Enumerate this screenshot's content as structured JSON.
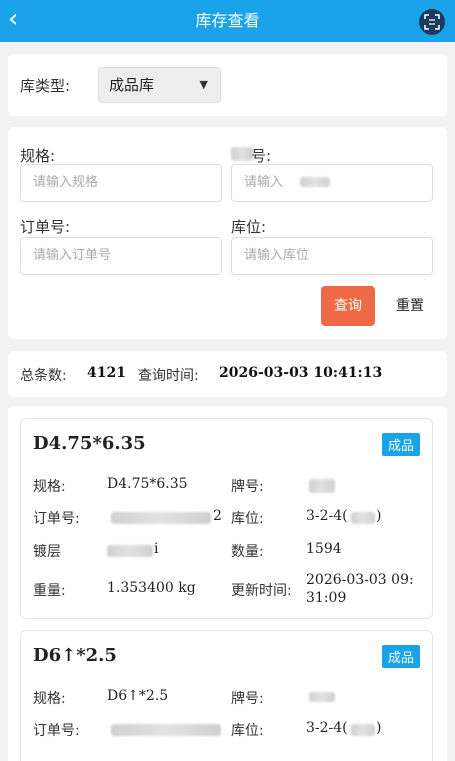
{
  "header": {
    "title": "库存查看",
    "back_icon": "chevron-left-icon",
    "scan_icon": "scan-icon"
  },
  "type_filter": {
    "label": "库类型:",
    "selected": "成品库"
  },
  "form": {
    "spec_label": "规格:",
    "spec_placeholder": "请输入规格",
    "brand_label": "号:",
    "brand_placeholder": "请输入",
    "order_label": "订单号:",
    "order_placeholder": "请输入订单号",
    "location_label": "库位:",
    "location_placeholder": "请输入库位",
    "query_button": "查询",
    "reset_button": "重置"
  },
  "summary": {
    "total_label": "总条数:",
    "total": "4121",
    "time_label": "查询时间:",
    "time": "2026-03-03 10:41:13"
  },
  "labels": {
    "spec": "规格:",
    "brand": "牌号:",
    "order": "订单号:",
    "location": "库位:",
    "plating": "镀层",
    "quantity": "数量:",
    "weight": "重量:",
    "updated": "更新时间:"
  },
  "items": [
    {
      "title": "D4.75*6.35",
      "badge": "成品",
      "spec": "D4.75*6.35",
      "order_tail": "2",
      "location": "3-2-4(",
      "location_tail": ")",
      "plating_tail": "i",
      "quantity": "1594",
      "weight": "1.353400 kg",
      "updated": "2026-03-03 09:31:09"
    },
    {
      "title": "D6↑*2.5",
      "badge": "成品",
      "spec": "D6↑*2.5",
      "location": "3-2-4(",
      "location_tail": ")"
    }
  ],
  "colors": {
    "primary": "#1aa3e8",
    "query": "#ee6a47"
  }
}
